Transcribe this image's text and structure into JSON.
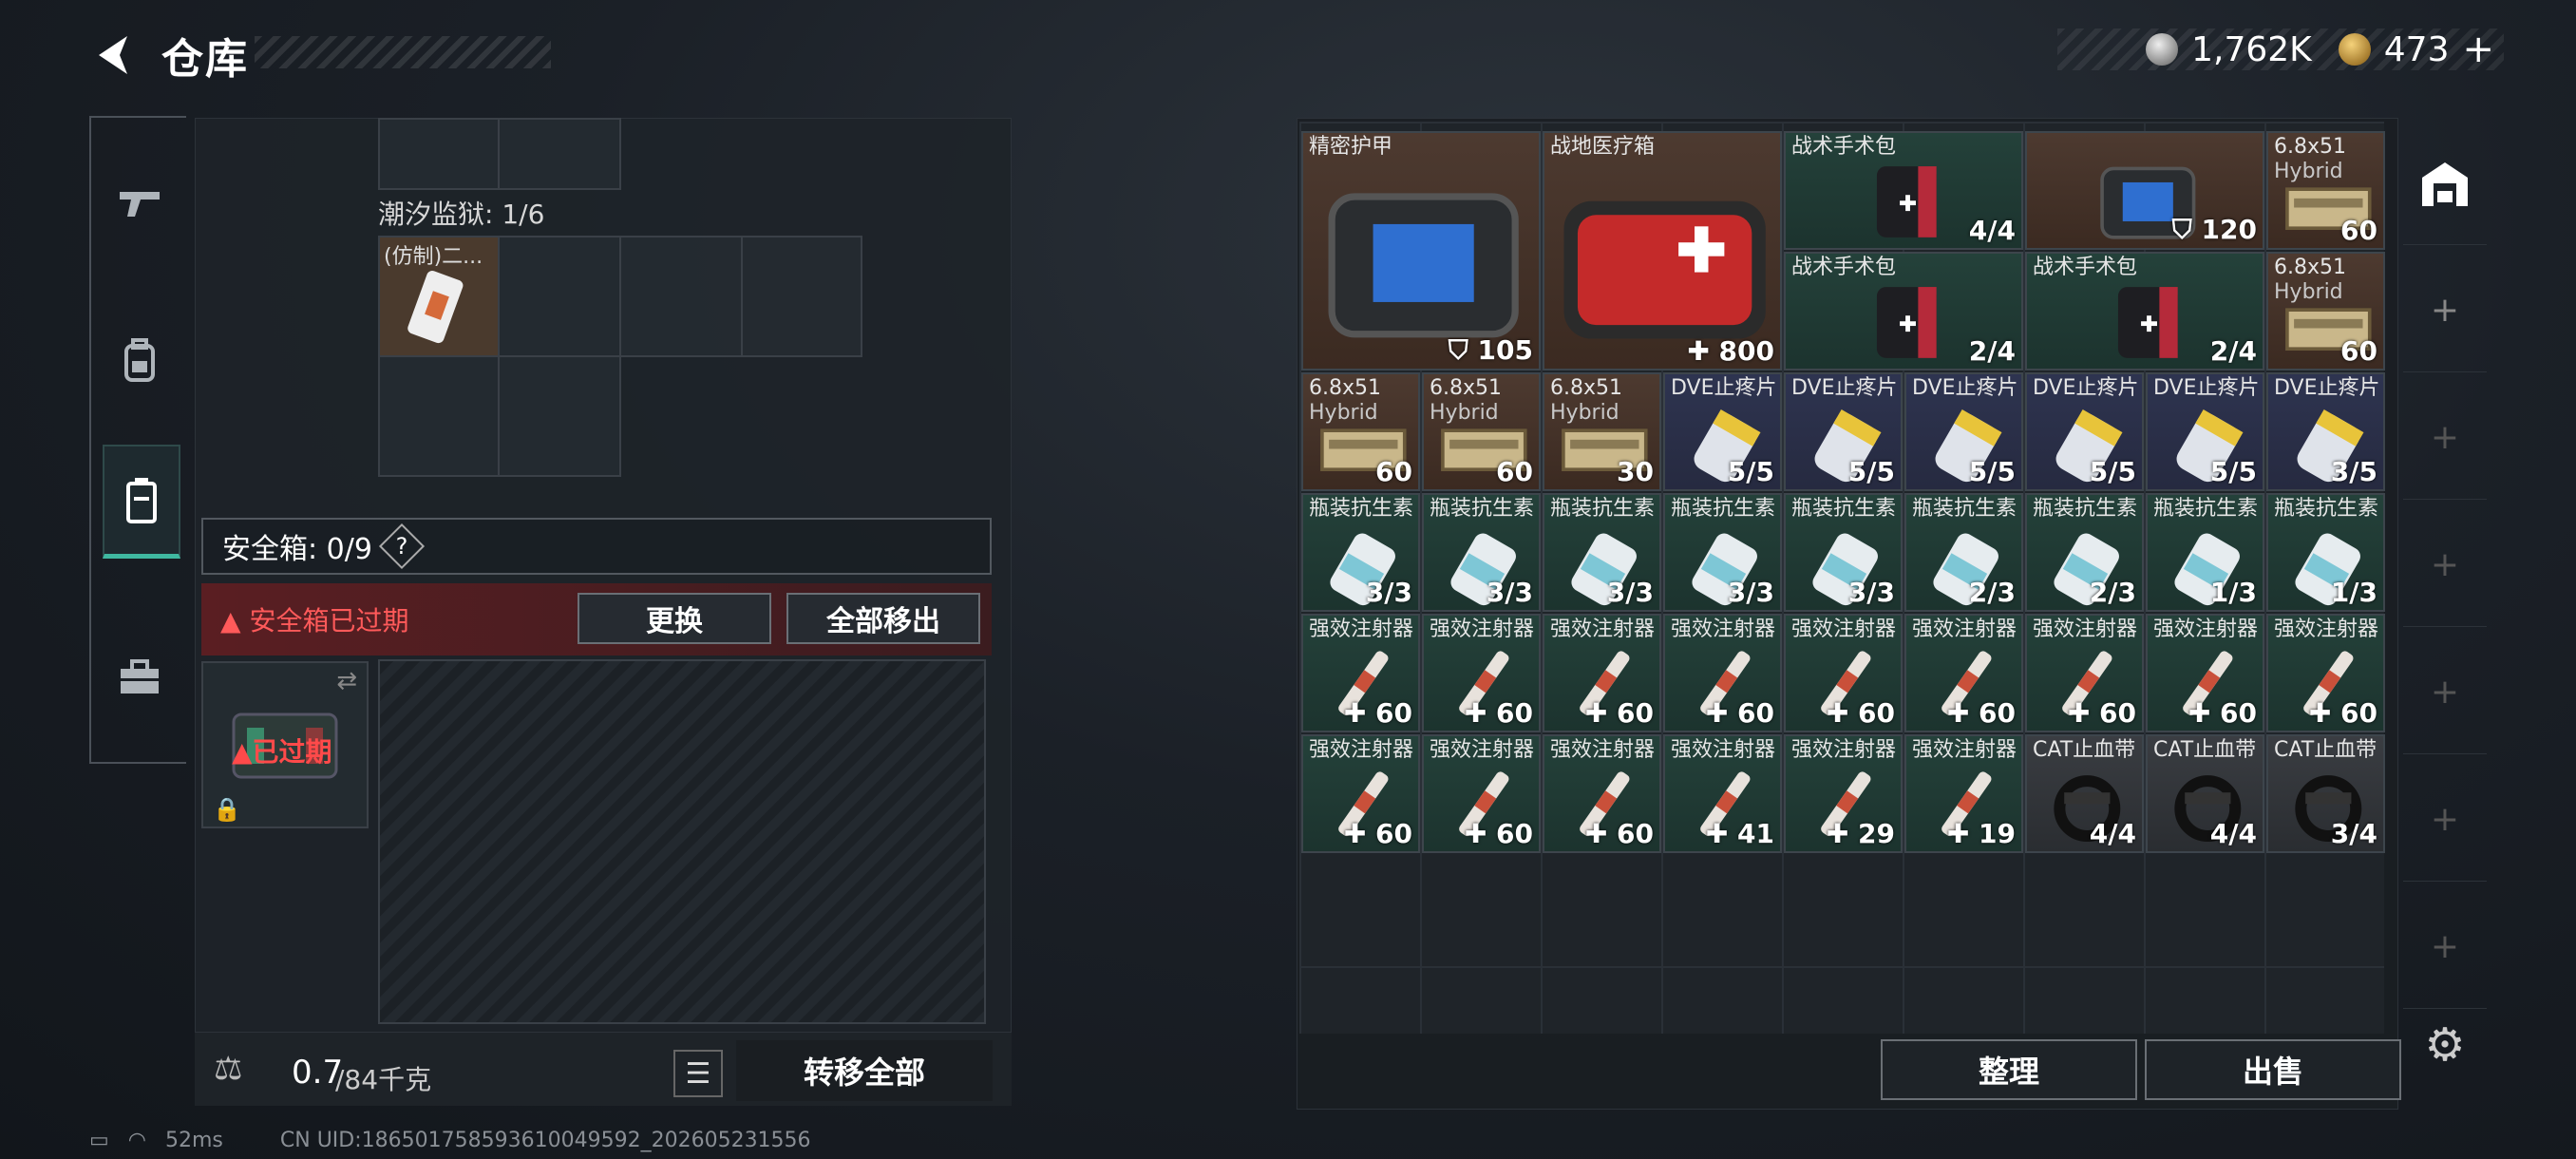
{
  "header": {
    "title": "仓库"
  },
  "currency": {
    "silver": "1,762K",
    "gold": "473"
  },
  "left": {
    "container_label": "潮汐监狱: 1/6",
    "item_in_container": "(仿制)二...",
    "safe_box_label": "安全箱: 0/9",
    "qmark": "?",
    "warning": "安全箱已过期",
    "btn_replace": "更换",
    "btn_move_all": "全部移出",
    "expired_label": "已过期",
    "weight_value": "0.7",
    "weight_max": "/84千克",
    "transfer_all": "转移全部"
  },
  "items": [
    {
      "name": "精密护甲",
      "name2": "",
      "count": "105",
      "prefix": "shield"
    },
    {
      "name": "战地医疗箱",
      "name2": "",
      "count": "800",
      "prefix": "plus"
    },
    {
      "name": "战术手术包",
      "name2": "",
      "count": "4/4",
      "prefix": ""
    },
    {
      "name": "",
      "name2": "",
      "count": "120",
      "prefix": "shield"
    },
    {
      "name": "6.8x51",
      "name2": "Hybrid",
      "count": "60",
      "prefix": ""
    },
    {
      "name": "战术手术包",
      "name2": "",
      "count": "2/4",
      "prefix": ""
    },
    {
      "name": "战术手术包",
      "name2": "",
      "count": "2/4",
      "prefix": ""
    },
    {
      "name": "6.8x51",
      "name2": "Hybrid",
      "count": "60",
      "prefix": ""
    },
    {
      "name": "6.8x51",
      "name2": "Hybrid",
      "count": "60",
      "prefix": ""
    },
    {
      "name": "6.8x51",
      "name2": "Hybrid",
      "count": "60",
      "prefix": ""
    },
    {
      "name": "6.8x51",
      "name2": "Hybrid",
      "count": "30",
      "prefix": ""
    },
    {
      "name": "DVE止疼片",
      "count": "5/5"
    },
    {
      "name": "DVE止疼片",
      "count": "5/5"
    },
    {
      "name": "DVE止疼片",
      "count": "5/5"
    },
    {
      "name": "DVE止疼片",
      "count": "5/5"
    },
    {
      "name": "DVE止疼片",
      "count": "5/5"
    },
    {
      "name": "DVE止疼片",
      "count": "3/5"
    },
    {
      "name": "瓶装抗生素",
      "count": "3/3"
    },
    {
      "name": "瓶装抗生素",
      "count": "3/3"
    },
    {
      "name": "瓶装抗生素",
      "count": "3/3"
    },
    {
      "name": "瓶装抗生素",
      "count": "3/3"
    },
    {
      "name": "瓶装抗生素",
      "count": "3/3"
    },
    {
      "name": "瓶装抗生素",
      "count": "2/3"
    },
    {
      "name": "瓶装抗生素",
      "count": "2/3"
    },
    {
      "name": "瓶装抗生素",
      "count": "1/3"
    },
    {
      "name": "瓶装抗生素",
      "count": "1/3"
    },
    {
      "name": "强效注射器",
      "count": "60"
    },
    {
      "name": "强效注射器",
      "count": "60"
    },
    {
      "name": "强效注射器",
      "count": "60"
    },
    {
      "name": "强效注射器",
      "count": "60"
    },
    {
      "name": "强效注射器",
      "count": "60"
    },
    {
      "name": "强效注射器",
      "count": "60"
    },
    {
      "name": "强效注射器",
      "count": "60"
    },
    {
      "name": "强效注射器",
      "count": "60"
    },
    {
      "name": "强效注射器",
      "count": "60"
    },
    {
      "name": "强效注射器",
      "count": "60"
    },
    {
      "name": "强效注射器",
      "count": "60"
    },
    {
      "name": "强效注射器",
      "count": "60"
    },
    {
      "name": "强效注射器",
      "count": "41"
    },
    {
      "name": "强效注射器",
      "count": "29"
    },
    {
      "name": "强效注射器",
      "count": "19"
    },
    {
      "name": "CAT止血带",
      "count": "4/4"
    },
    {
      "name": "CAT止血带",
      "count": "4/4"
    },
    {
      "name": "CAT止血带",
      "count": "3/4"
    }
  ],
  "right": {
    "sort": "整理",
    "sell": "出售"
  },
  "footer": {
    "ping": "52ms",
    "uid": "CN UID:1865017585936100495​92_202605231556"
  }
}
